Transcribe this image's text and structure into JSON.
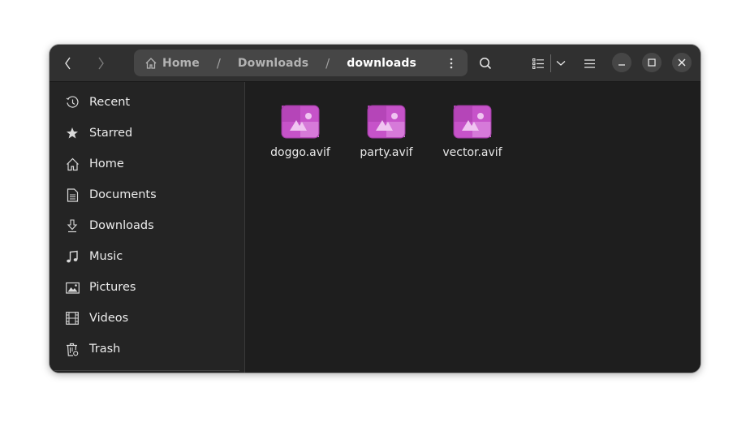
{
  "header": {
    "back_icon": "chevron-left-icon",
    "forward_icon": "chevron-right-icon",
    "breadcrumb": [
      {
        "label": "Home",
        "icon": "home-icon"
      },
      {
        "label": "Downloads"
      },
      {
        "label": "downloads",
        "current": true
      }
    ],
    "separator": "/",
    "path_menu_icon": "vertical-dots-icon",
    "search_icon": "search-icon",
    "view_icon": "list-view-icon",
    "view_dropdown_icon": "chevron-down-icon",
    "main_menu_icon": "hamburger-menu-icon",
    "window_controls": [
      "minimize",
      "maximize",
      "close"
    ]
  },
  "sidebar": {
    "items": [
      {
        "label": "Recent",
        "icon": "clock-icon"
      },
      {
        "label": "Starred",
        "icon": "star-icon"
      },
      {
        "label": "Home",
        "icon": "home-icon"
      },
      {
        "label": "Documents",
        "icon": "document-icon"
      },
      {
        "label": "Downloads",
        "icon": "download-icon"
      },
      {
        "label": "Music",
        "icon": "music-icon"
      },
      {
        "label": "Pictures",
        "icon": "picture-icon"
      },
      {
        "label": "Videos",
        "icon": "film-icon"
      },
      {
        "label": "Trash",
        "icon": "trash-icon"
      }
    ]
  },
  "files": [
    {
      "name": "doggo.avif",
      "icon": "image-file-icon"
    },
    {
      "name": "party.avif",
      "icon": "image-file-icon"
    },
    {
      "name": "vector.avif",
      "icon": "image-file-icon"
    }
  ],
  "colors": {
    "headerbar": "#303030",
    "sidebar": "#242424",
    "content": "#1e1e1e",
    "pathbar": "#464646",
    "file_icon": "#c44fc4"
  }
}
